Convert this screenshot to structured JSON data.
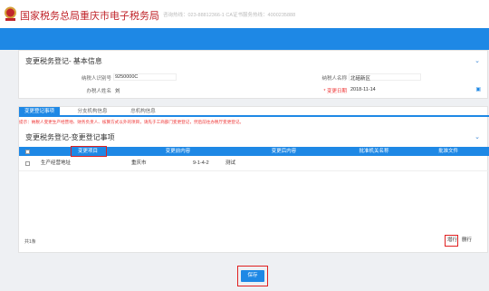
{
  "header": {
    "brand": "国家税务总局重庆市电子税务局",
    "hotline": "咨询热线：023-88812366-1  CA证书服务热线：4000235888"
  },
  "basic": {
    "title": "变更税务登记- 基本信息",
    "taxpayer_id_label": "纳税人识别号",
    "taxpayer_id_value": "9250000C",
    "taxpayer_name_label": "纳税人名称",
    "taxpayer_name_value": "北碚新区",
    "handler_label": "办税人姓名",
    "handler_value": "刘",
    "date_label": "* 变更日期",
    "date_value": "2018-11-14"
  },
  "tabs": [
    "变更登记事项",
    "分支机构信息",
    "总机构信息"
  ],
  "notice": "提示：纳税人变更生产经营地、财务负责人、核算方式以外的项目，请先于工商部门变更登记，然后前往办税厅变更登记。",
  "section_title": "变更税务登记-变更登记事项",
  "table": {
    "headers": [
      "变更项目",
      "变更前内容",
      "变更后内容",
      "批准机关名称",
      "批准文件"
    ],
    "rows": [
      {
        "item": "生产经营地址",
        "before": "重庆市",
        "before_num": "9-1-4-2",
        "after": "测试",
        "approver": "",
        "doc": ""
      }
    ]
  },
  "footer": {
    "total": "共1条",
    "add": "增行",
    "delete": "删行"
  },
  "submit": "保存",
  "colors": {
    "accent": "#1e88e5",
    "brand": "#c0262c",
    "highlight": "#e02020"
  }
}
